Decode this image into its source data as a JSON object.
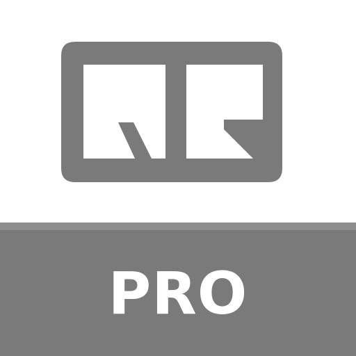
{
  "icon": {
    "logo": "qr-logo-icon",
    "badge_label": "PRO"
  },
  "colors": {
    "background": "#ffffff",
    "logo": "#7a7a7a",
    "banner": "#7a7a7a",
    "banner_stripe": "#8e8e8e",
    "label": "#ffffff"
  }
}
